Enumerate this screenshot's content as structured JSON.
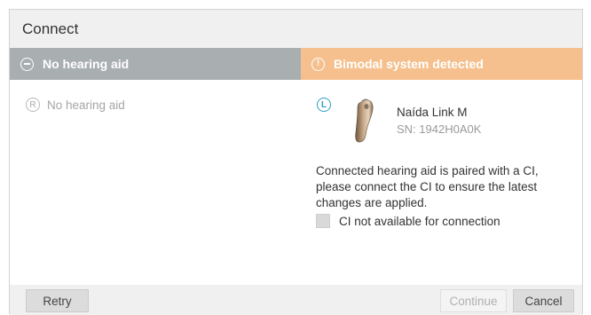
{
  "dialog": {
    "title": "Connect"
  },
  "left_panel": {
    "header": "No hearing aid",
    "header_icon": "minus-circle-icon",
    "header_color": "#a9aeb1",
    "side_badge": "R",
    "device_label": "No hearing aid"
  },
  "right_panel": {
    "header": "Bimodal system detected",
    "header_icon": "warning-circle-icon",
    "header_icon_glyph": "!",
    "header_color": "#f5c08e",
    "side_badge": "L",
    "side_badge_color": "#2f9fc2",
    "device_name": "Naída Link M",
    "device_sn": "SN: 1942H0A0K",
    "message": "Connected hearing aid is paired with a CI, please connect the CI to ensure the latest changes are applied.",
    "checkbox_label": "CI not available for connection",
    "checkbox_checked": false
  },
  "footer": {
    "retry_label": "Retry",
    "continue_label": "Continue",
    "continue_enabled": false,
    "cancel_label": "Cancel"
  }
}
